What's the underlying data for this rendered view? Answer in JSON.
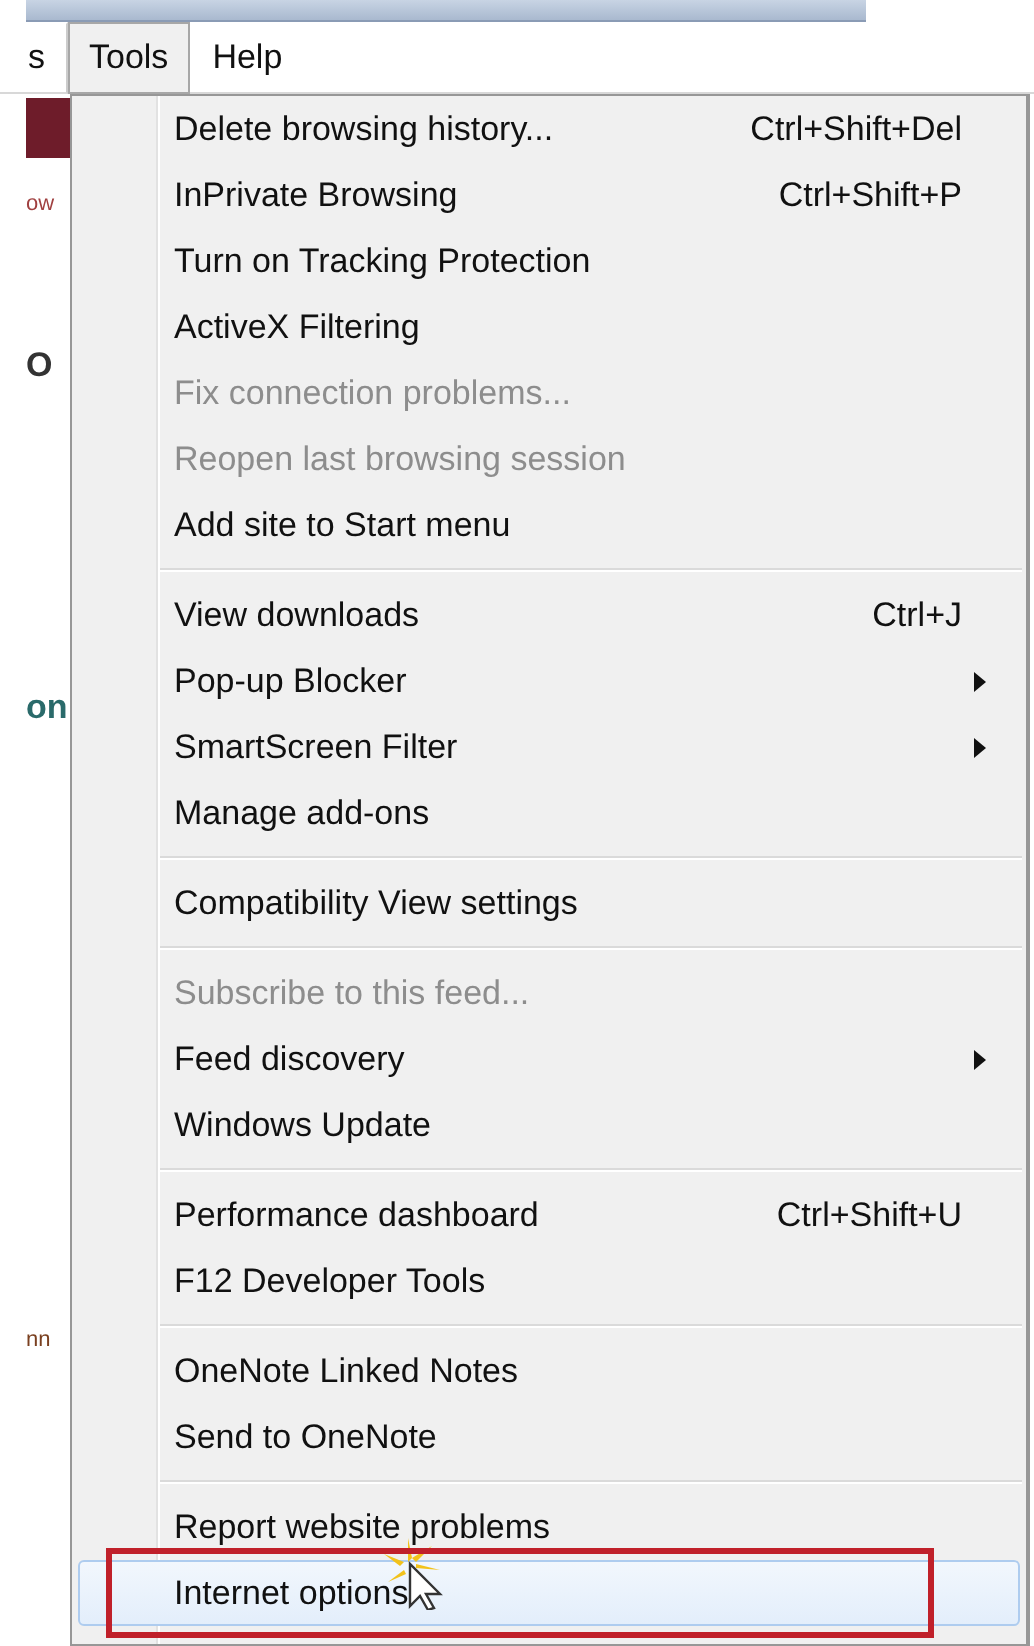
{
  "menu_bar": [
    {
      "label": "s",
      "selected": false
    },
    {
      "label": "Tools",
      "selected": true
    },
    {
      "label": "Help",
      "selected": false
    }
  ],
  "page_fragments": [
    {
      "kind": "banner"
    },
    {
      "kind": "text",
      "text": "ow",
      "color": "#a04040"
    },
    {
      "kind": "heading",
      "text": "O",
      "color": "#333333"
    },
    {
      "kind": "heading",
      "text": "on",
      "color": "#2a6a6a"
    },
    {
      "kind": "text",
      "text": "nn",
      "color": "#7a4020"
    }
  ],
  "tools_menu": {
    "groups": [
      [
        {
          "label": "Delete browsing history...",
          "shortcut": "Ctrl+Shift+Del",
          "submenu": false,
          "disabled": false,
          "selected": false,
          "outlined": false
        },
        {
          "label": "InPrivate Browsing",
          "shortcut": "Ctrl+Shift+P",
          "submenu": false,
          "disabled": false,
          "selected": false,
          "outlined": false
        },
        {
          "label": "Turn on Tracking Protection",
          "submenu": false,
          "disabled": false,
          "selected": false,
          "outlined": false
        },
        {
          "label": "ActiveX Filtering",
          "submenu": false,
          "disabled": false,
          "selected": false,
          "outlined": false
        },
        {
          "label": "Fix connection problems...",
          "submenu": false,
          "disabled": true,
          "selected": false,
          "outlined": false
        },
        {
          "label": "Reopen last browsing session",
          "submenu": false,
          "disabled": true,
          "selected": false,
          "outlined": false
        },
        {
          "label": "Add site to Start menu",
          "submenu": false,
          "disabled": false,
          "selected": false,
          "outlined": false
        }
      ],
      [
        {
          "label": "View downloads",
          "shortcut": "Ctrl+J",
          "submenu": false,
          "disabled": false,
          "selected": false,
          "outlined": false
        },
        {
          "label": "Pop-up Blocker",
          "submenu": true,
          "disabled": false,
          "selected": false,
          "outlined": false
        },
        {
          "label": "SmartScreen Filter",
          "submenu": true,
          "disabled": false,
          "selected": false,
          "outlined": false
        },
        {
          "label": "Manage add-ons",
          "submenu": false,
          "disabled": false,
          "selected": false,
          "outlined": false
        }
      ],
      [
        {
          "label": "Compatibility View settings",
          "submenu": false,
          "disabled": false,
          "selected": false,
          "outlined": false
        }
      ],
      [
        {
          "label": "Subscribe to this feed...",
          "submenu": false,
          "disabled": true,
          "selected": false,
          "outlined": false
        },
        {
          "label": "Feed discovery",
          "submenu": true,
          "disabled": false,
          "selected": false,
          "outlined": false
        },
        {
          "label": "Windows Update",
          "submenu": false,
          "disabled": false,
          "selected": false,
          "outlined": false
        }
      ],
      [
        {
          "label": "Performance dashboard",
          "shortcut": "Ctrl+Shift+U",
          "submenu": false,
          "disabled": false,
          "selected": false,
          "outlined": false
        },
        {
          "label": "F12 Developer Tools",
          "submenu": false,
          "disabled": false,
          "selected": false,
          "outlined": false
        }
      ],
      [
        {
          "label": "OneNote Linked Notes",
          "submenu": false,
          "disabled": false,
          "selected": false,
          "outlined": false
        },
        {
          "label": "Send to OneNote",
          "submenu": false,
          "disabled": false,
          "selected": false,
          "outlined": false
        }
      ],
      [
        {
          "label": "Report website problems",
          "submenu": false,
          "disabled": false,
          "selected": false,
          "outlined": false
        },
        {
          "label": "Internet options",
          "submenu": false,
          "disabled": false,
          "selected": true,
          "outlined": true
        }
      ]
    ]
  }
}
